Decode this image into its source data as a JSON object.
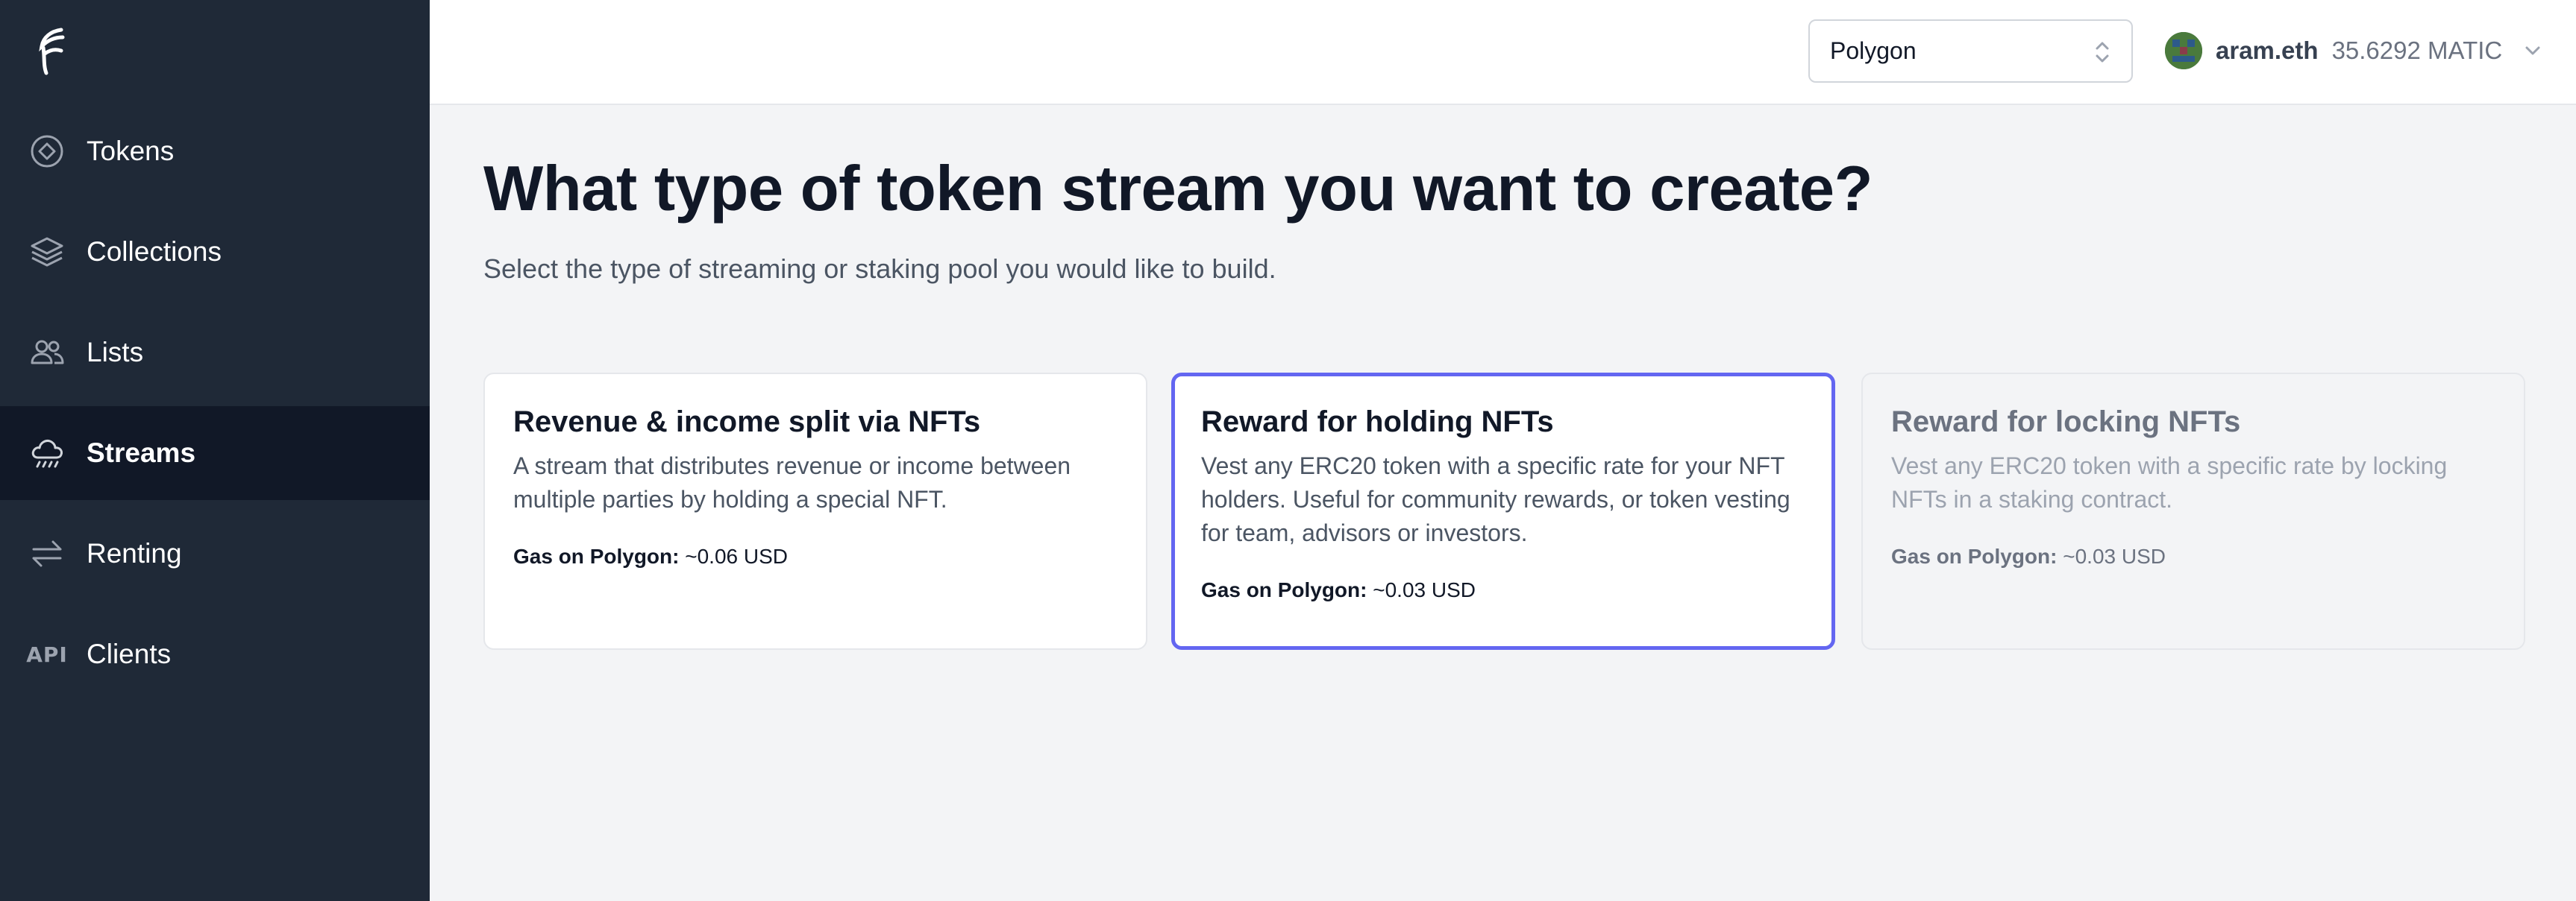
{
  "sidebar": {
    "logo": "brand-logo",
    "items": [
      {
        "label": "Tokens",
        "icon": "token-diamond-icon"
      },
      {
        "label": "Collections",
        "icon": "layers-icon"
      },
      {
        "label": "Lists",
        "icon": "users-icon"
      },
      {
        "label": "Streams",
        "icon": "cloud-rain-icon",
        "active": true
      },
      {
        "label": "Renting",
        "icon": "arrows-exchange-icon"
      },
      {
        "label": "Clients",
        "icon": "api-icon",
        "icon_text": "API"
      }
    ]
  },
  "topbar": {
    "network": {
      "selected": "Polygon"
    },
    "account": {
      "name": "aram.eth",
      "balance": "35.6292 MATIC"
    }
  },
  "main": {
    "title": "What type of token stream you want to create?",
    "subtitle": "Select the type of streaming or staking pool you would like to build.",
    "cards": [
      {
        "title": "Revenue & income split via NFTs",
        "description": "A stream that distributes revenue or income between multiple parties by holding a special NFT.",
        "gas_label": "Gas on Polygon:",
        "gas_value": "~0.06 USD"
      },
      {
        "title": "Reward for holding NFTs",
        "description": "Vest any ERC20 token with a specific rate for your NFT holders. Useful for community rewards, or token vesting for team, advisors or investors.",
        "gas_label": "Gas on Polygon:",
        "gas_value": "~0.03 USD"
      },
      {
        "title": "Reward for locking NFTs",
        "description": "Vest any ERC20 token with a specific rate by locking NFTs in a staking contract.",
        "gas_label": "Gas on Polygon:",
        "gas_value": "~0.03 USD"
      }
    ]
  },
  "colors": {
    "sidebar_bg": "#1f2937",
    "sidebar_active_bg": "#111827",
    "accent": "#6366f1",
    "page_bg": "#f3f4f6"
  }
}
